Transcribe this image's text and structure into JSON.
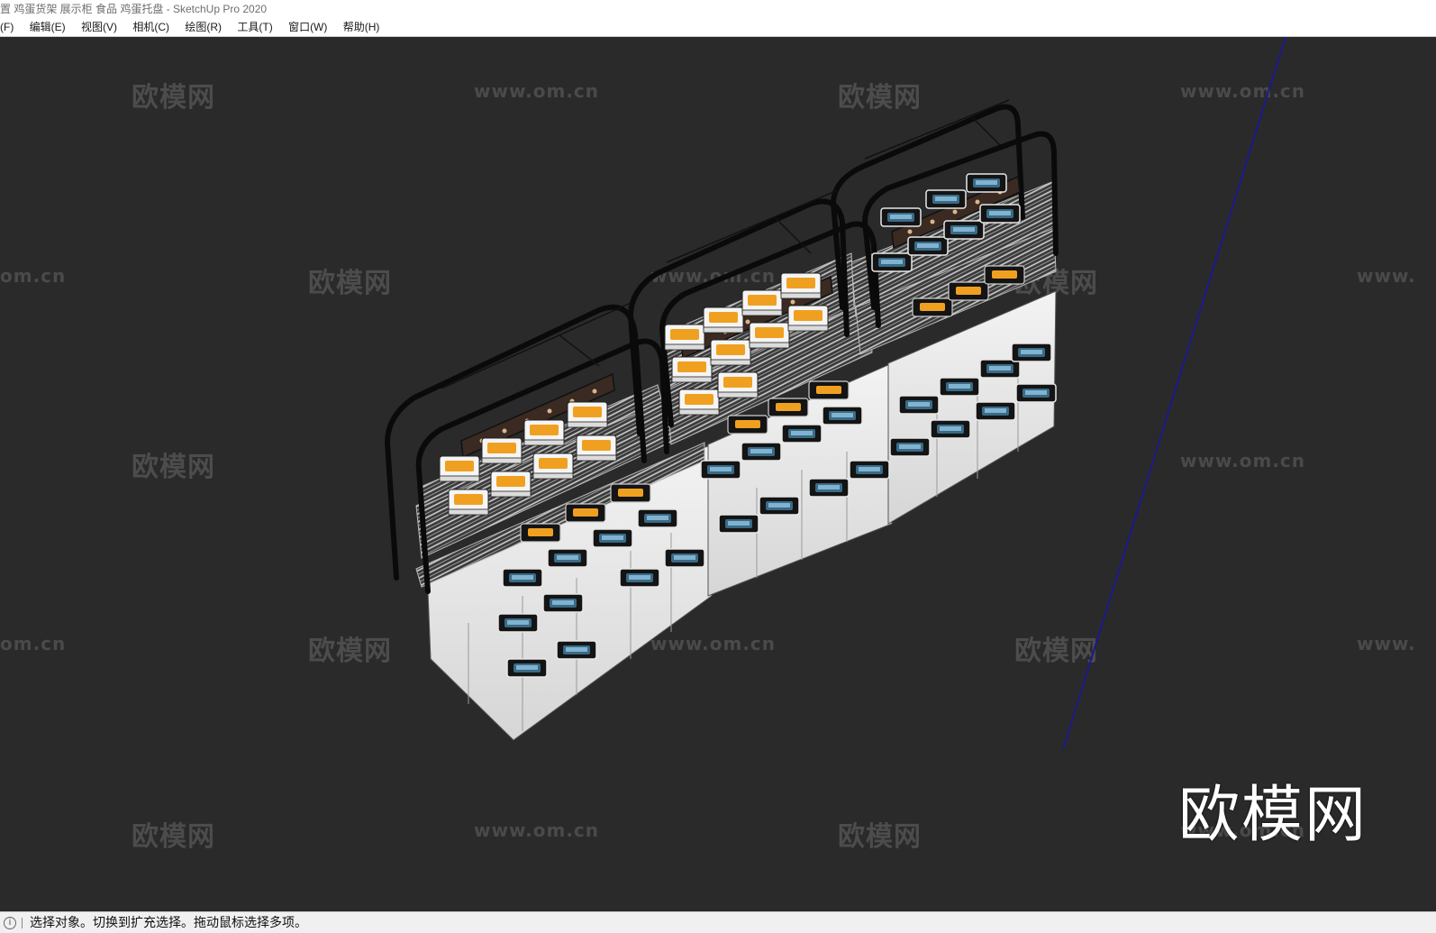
{
  "window": {
    "title": "置 鸡蛋货架 展示柜 食品 鸡蛋托盘 - SketchUp Pro 2020"
  },
  "menu": {
    "items": [
      {
        "label": "(F)"
      },
      {
        "label": "编辑(E)"
      },
      {
        "label": "视图(V)"
      },
      {
        "label": "相机(C)"
      },
      {
        "label": "绘图(R)"
      },
      {
        "label": "工具(T)"
      },
      {
        "label": "窗口(W)"
      },
      {
        "label": "帮助(H)"
      }
    ]
  },
  "watermark": {
    "brand": "欧模网",
    "url": "www.om.cn",
    "url_partial_left": "om.cn",
    "url_partial_right": "www.",
    "corner_logo": "欧模网"
  },
  "status": {
    "icon": "info-icon",
    "text": "选择对象。切换到扩充选择。拖动鼠标选择多项。"
  },
  "colors": {
    "viewport_bg": "#2a2a2a",
    "axis_blue": "#1a1a8c",
    "egg_yolk": "#f0a020"
  }
}
